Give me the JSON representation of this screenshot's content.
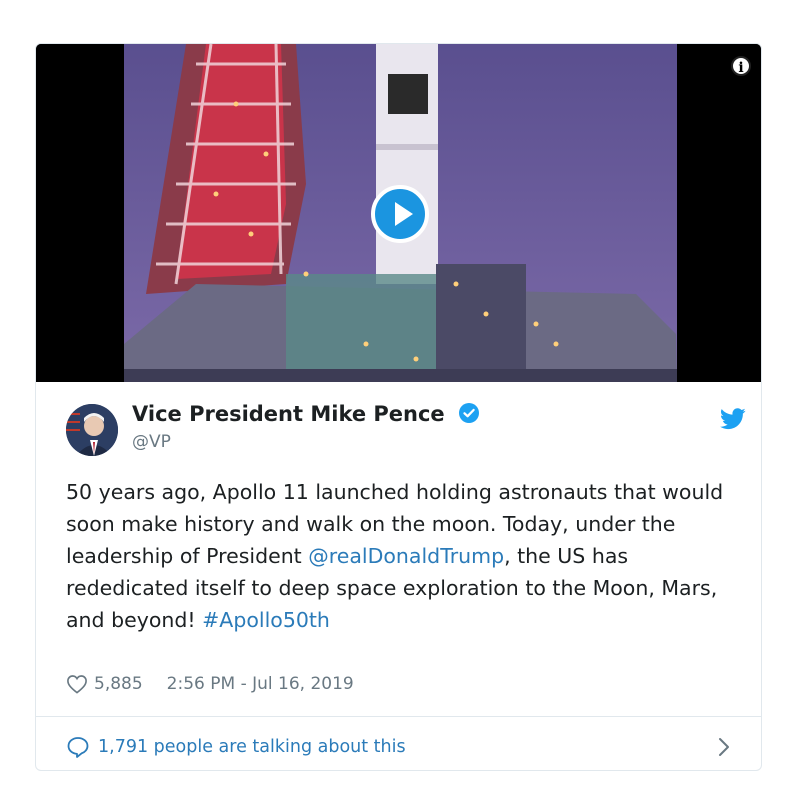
{
  "media": {
    "play_icon": "play-icon",
    "info_icon": "info-icon"
  },
  "author": {
    "name": "Vice President Mike Pence",
    "handle": "@VP",
    "verified_icon": "verified-badge-icon",
    "platform_icon": "twitter-bird-icon"
  },
  "tweet": {
    "text_part1": "50 years ago, Apollo 11 launched holding astronauts that would soon make history and walk on the moon. Today, under the leadership of President ",
    "mention": "@realDonaldTrump",
    "text_part2": ", the US has rededicated itself to deep space exploration to the Moon, Mars, and beyond! ",
    "hashtag": "#Apollo50th"
  },
  "meta": {
    "likes": "5,885",
    "timestamp": "2:56 PM - Jul 16, 2019"
  },
  "footer": {
    "talking": "1,791 people are talking about this"
  },
  "colors": {
    "link": "#2b7bb9",
    "twitter_blue": "#1da1f2",
    "muted": "#697882"
  }
}
